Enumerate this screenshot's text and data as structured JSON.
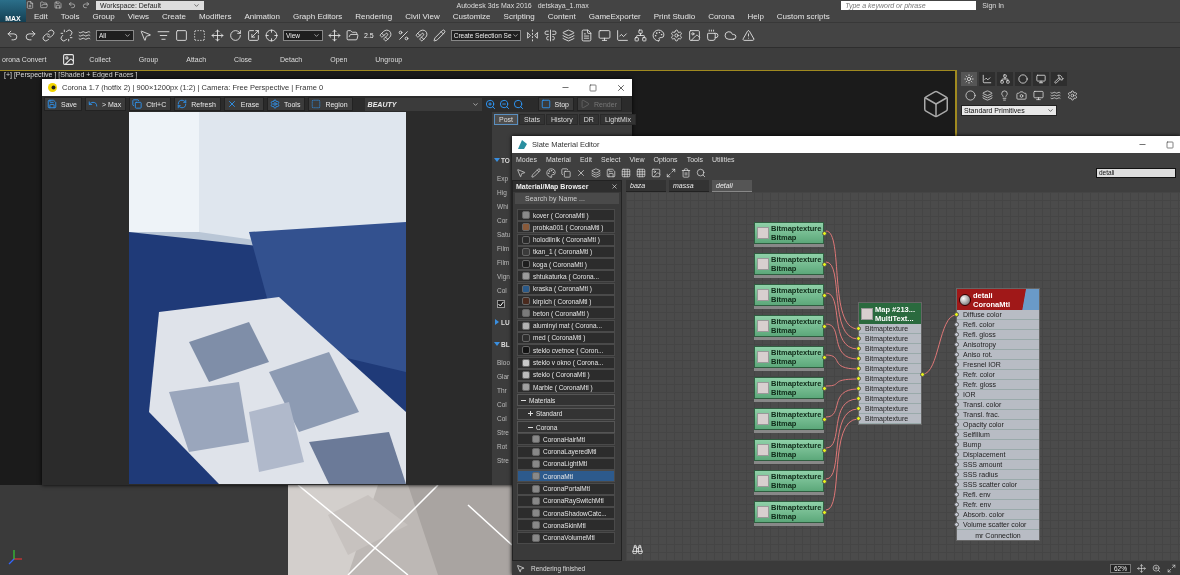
{
  "app": {
    "logo": "MAX",
    "workspace": "Workspace: Default",
    "title": "Autodesk 3ds Max 2016",
    "file": "detskaya_1.max",
    "search_placeholder": "Type a keyword or phrase",
    "sign_in": "Sign In"
  },
  "menu": [
    "Edit",
    "Tools",
    "Group",
    "Views",
    "Create",
    "Modifiers",
    "Animation",
    "Graph Editors",
    "Rendering",
    "Civil View",
    "Customize",
    "Scripting",
    "Content",
    "GameExporter",
    "Print Studio",
    "Corona",
    "Help",
    "Custom scripts"
  ],
  "toolbar": {
    "selection_filter": "All",
    "reference_coord": "View",
    "snap_value": "2.5",
    "named_selection": "Create Selection Se"
  },
  "ribbon": [
    "orona Convert",
    "Collect",
    "Group",
    "Attach",
    "Close",
    "Detach",
    "Open",
    "Ungroup"
  ],
  "viewport": {
    "label": "[+] [Perspective ] [Shaded + Edged Faces ]"
  },
  "command_panel": {
    "dropdown": "Standard Primitives"
  },
  "render_window": {
    "title": "Corona 1.7 (hotfix 2) | 900×1200px (1:2) | Camera: Free Perspective | Frame 0",
    "toolbar": [
      {
        "label": "Save"
      },
      {
        "label": "> Max"
      },
      {
        "label": "Ctrl+C"
      },
      {
        "label": "Refresh"
      },
      {
        "label": "Erase"
      },
      {
        "label": "Tools"
      },
      {
        "label": "Region"
      }
    ],
    "channel": "BEAUTY",
    "actions": [
      {
        "label": "Stop",
        "disabled": false
      },
      {
        "label": "Render",
        "disabled": true
      }
    ],
    "tabs": [
      {
        "label": "Post",
        "selected": true
      },
      {
        "label": "Stats",
        "selected": false
      },
      {
        "label": "History",
        "selected": false
      },
      {
        "label": "DR",
        "selected": false
      },
      {
        "label": "LightMix",
        "selected": false
      }
    ],
    "panel": [
      {
        "kind": "section",
        "text": "TO",
        "expanded": true
      },
      {
        "kind": "label",
        "text": "Exp"
      },
      {
        "kind": "label",
        "text": "Hig"
      },
      {
        "kind": "label",
        "text": "Whi"
      },
      {
        "kind": "label",
        "text": "Cor"
      },
      {
        "kind": "label",
        "text": "Satu"
      },
      {
        "kind": "label",
        "text": "Film"
      },
      {
        "kind": "label",
        "text": "Film"
      },
      {
        "kind": "label",
        "text": "Vign"
      },
      {
        "kind": "label",
        "text": "Col"
      },
      {
        "kind": "checkbox",
        "checked": true
      },
      {
        "kind": "section",
        "text": "LU",
        "expanded": false
      },
      {
        "kind": "section",
        "text": "BL",
        "expanded": true
      },
      {
        "kind": "label",
        "text": "Bloo"
      },
      {
        "kind": "label",
        "text": "Glar"
      },
      {
        "kind": "label",
        "text": "Thr"
      },
      {
        "kind": "label",
        "text": "Col"
      },
      {
        "kind": "label",
        "text": "Col"
      },
      {
        "kind": "label",
        "text": "Stre"
      },
      {
        "kind": "label",
        "text": "Rot"
      },
      {
        "kind": "label",
        "text": "Stre"
      }
    ]
  },
  "slate_editor": {
    "title": "Slate Material Editor",
    "menu": [
      "Modes",
      "Material",
      "Edit",
      "Select",
      "View",
      "Options",
      "Tools",
      "Utilities"
    ],
    "search_value": "detali",
    "browser": {
      "title": "Material/Map Browser",
      "search_placeholder": "Search by Name ...",
      "scene_materials": [
        {
          "name": "kover  ( CoronaMtl )",
          "color": "#8a8a8a"
        },
        {
          "name": "probka001  ( CoronaMtl )",
          "color": "#8a5a3a"
        },
        {
          "name": "holodilnik  ( CoronaMtl )",
          "color": "#2a2a2a"
        },
        {
          "name": "tkan_1  ( CoronaMtl )",
          "color": "#3a3a3a"
        },
        {
          "name": "koga  ( CoronaMtl )",
          "color": "#1e1e1e"
        },
        {
          "name": "shtukaturka  ( Corona...",
          "color": "#9a9a9a"
        },
        {
          "name": "kraska  ( CoronaMtl )",
          "color": "#2a5a8a"
        },
        {
          "name": "kirpich  ( CoronaMtl )",
          "color": "#4a2a1e"
        },
        {
          "name": "beton  ( CoronaMtl )",
          "color": "#7a7a7a"
        },
        {
          "name": "aluminyi mat  ( Corona...",
          "color": "#b0b0b0"
        },
        {
          "name": "med  ( CoronaMtl )",
          "color": "#2e2e2e"
        },
        {
          "name": "steklo cvetnoe  ( Coron...",
          "color": "#141414"
        },
        {
          "name": "steklo v okno  ( Corona...",
          "color": "#c8c8c8"
        },
        {
          "name": "steklo  ( CoronaMtl )",
          "color": "#bcbcbc"
        },
        {
          "name": "Marble  ( CoronaMtl )",
          "color": "#a0a0a0"
        }
      ],
      "groups": [
        {
          "label": "Materials",
          "expanded": true,
          "children": [
            {
              "label": "Standard",
              "expanded": false
            },
            {
              "label": "Corona",
              "expanded": true,
              "children": [
                {
                  "label": "CoronaHairMtl",
                  "selected": false
                },
                {
                  "label": "CoronaLayeredMtl",
                  "selected": false
                },
                {
                  "label": "CoronaLightMtl",
                  "selected": false
                },
                {
                  "label": "CoronaMtl",
                  "selected": true
                },
                {
                  "label": "CoronaPortalMtl",
                  "selected": false
                },
                {
                  "label": "CoronaRaySwitchMtl",
                  "selected": false
                },
                {
                  "label": "CoronaShadowCatc...",
                  "selected": false
                },
                {
                  "label": "CoronaSkinMtl",
                  "selected": false
                },
                {
                  "label": "CoronaVolumeMtl",
                  "selected": false
                }
              ]
            }
          ]
        }
      ]
    },
    "view_tabs": [
      {
        "label": "baza",
        "selected": false
      },
      {
        "label": "massa",
        "selected": false
      },
      {
        "label": "detali",
        "selected": true
      }
    ],
    "bitmap_nodes": [
      {
        "title": "Bitmaptexture",
        "type": "Bitmap"
      },
      {
        "title": "Bitmaptexture",
        "type": "Bitmap"
      },
      {
        "title": "Bitmaptexture",
        "type": "Bitmap"
      },
      {
        "title": "Bitmaptexture",
        "type": "Bitmap"
      },
      {
        "title": "Bitmaptexture",
        "type": "Bitmap"
      },
      {
        "title": "Bitmaptexture",
        "type": "Bitmap"
      },
      {
        "title": "Bitmaptexture",
        "type": "Bitmap"
      },
      {
        "title": "Bitmaptexture",
        "type": "Bitmap"
      },
      {
        "title": "Bitmaptexture",
        "type": "Bitmap"
      },
      {
        "title": "Bitmaptexture",
        "type": "Bitmap"
      }
    ],
    "multi_node": {
      "title": "Map #213...",
      "type": "MultiText...",
      "slots": [
        "Bitmaptexture",
        "Bitmaptexture",
        "Bitmaptexture",
        "Bitmaptexture",
        "Bitmaptexture",
        "Bitmaptexture",
        "Bitmaptexture",
        "Bitmaptexture",
        "Bitmaptexture",
        "Bitmaptexture"
      ]
    },
    "material_node": {
      "title": "detali",
      "type": "CoronaMtl",
      "slots": [
        "Diffuse color",
        "Refl. color",
        "Refl. gloss",
        "Anisotropy",
        "Aniso rot.",
        "Fresnel IOR",
        "Refr. color",
        "Refr. gloss",
        "IOR",
        "Transl. color",
        "Transl. frac.",
        "Opacity color",
        "SelfIllum",
        "Bump",
        "Displacement",
        "SSS amount",
        "SSS radius",
        "SSS scatter color",
        "Refl. env",
        "Refr. env",
        "Absorb. color",
        "Volume scatter color"
      ],
      "footer": "mr Connection"
    },
    "status": "Rendering finished",
    "zoom": "62%"
  }
}
